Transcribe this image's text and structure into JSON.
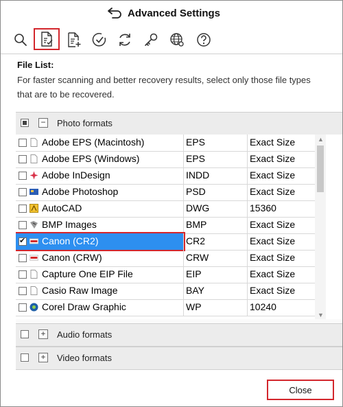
{
  "window": {
    "title": "Advanced Settings",
    "back_icon": "back-arrow-icon"
  },
  "toolbar": {
    "buttons": [
      {
        "icon": "search-icon"
      },
      {
        "icon": "file-list-icon",
        "active": true
      },
      {
        "icon": "add-file-icon"
      },
      {
        "icon": "checkmark-circle-icon"
      },
      {
        "icon": "refresh-icon"
      },
      {
        "icon": "key-icon"
      },
      {
        "icon": "globe-settings-icon"
      },
      {
        "icon": "help-icon"
      }
    ]
  },
  "file_list": {
    "title": "File List:",
    "description": "For faster scanning and better recovery results, select only those file types that are to be recovered."
  },
  "groups": {
    "photo": {
      "label": "Photo formats",
      "expander": "−"
    },
    "audio": {
      "label": "Audio formats",
      "expander": "+"
    },
    "video": {
      "label": "Video formats",
      "expander": "+"
    }
  },
  "rows": [
    {
      "name": "Adobe EPS (Macintosh)",
      "ext": "EPS",
      "size": "Exact Size",
      "icon": "doc-icon",
      "checked": false
    },
    {
      "name": "Adobe EPS (Windows)",
      "ext": "EPS",
      "size": "Exact Size",
      "icon": "doc-icon",
      "checked": false
    },
    {
      "name": "Adobe InDesign",
      "ext": "INDD",
      "size": "Exact Size",
      "icon": "indesign-icon",
      "checked": false
    },
    {
      "name": "Adobe Photoshop",
      "ext": "PSD",
      "size": "Exact Size",
      "icon": "photoshop-icon",
      "checked": false
    },
    {
      "name": "AutoCAD",
      "ext": "DWG",
      "size": "15360",
      "icon": "autocad-icon",
      "checked": false
    },
    {
      "name": "BMP Images",
      "ext": "BMP",
      "size": "Exact Size",
      "icon": "bmp-icon",
      "checked": false
    },
    {
      "name": "Canon (CR2)",
      "ext": "CR2",
      "size": "Exact Size",
      "icon": "canon-icon",
      "checked": true
    },
    {
      "name": "Canon (CRW)",
      "ext": "CRW",
      "size": "Exact Size",
      "icon": "canon-icon",
      "checked": false
    },
    {
      "name": "Capture One EIP File",
      "ext": "EIP",
      "size": "Exact Size",
      "icon": "doc-icon",
      "checked": false
    },
    {
      "name": "Casio Raw Image",
      "ext": "BAY",
      "size": "Exact Size",
      "icon": "doc-icon",
      "checked": false
    },
    {
      "name": "Corel Draw Graphic",
      "ext": "WP",
      "size": "10240",
      "icon": "corel-icon",
      "checked": false
    }
  ],
  "footer": {
    "close_label": "Close"
  },
  "colors": {
    "accent_red": "#d3262c",
    "selection_blue": "#2d8ff0"
  }
}
